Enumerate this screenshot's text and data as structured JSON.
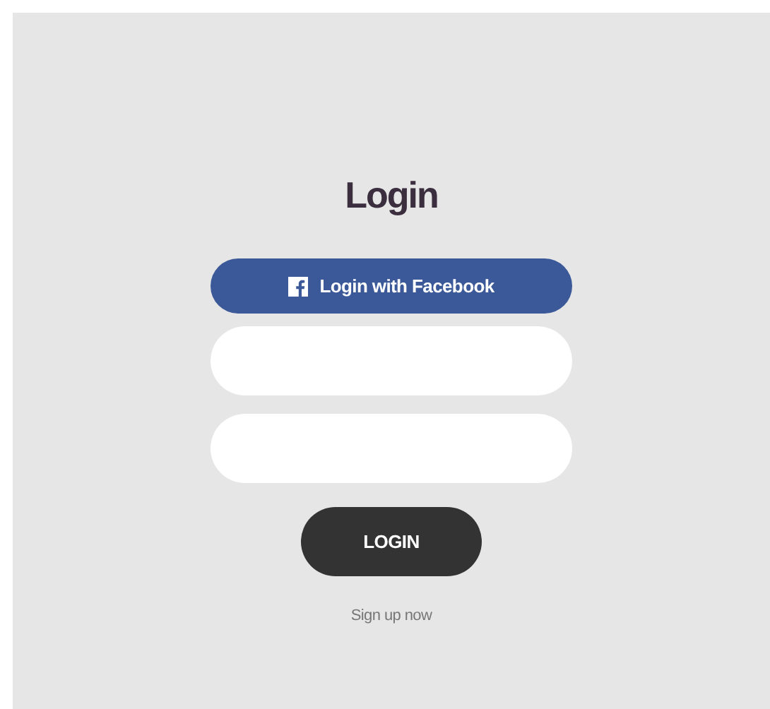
{
  "title": "Login",
  "facebook_button": {
    "label": "Login with Facebook"
  },
  "fields": [
    {
      "kind": "input"
    },
    {
      "kind": "input"
    }
  ],
  "login_button": {
    "label": "LOGIN"
  },
  "signup_link": {
    "label": "Sign up now"
  }
}
